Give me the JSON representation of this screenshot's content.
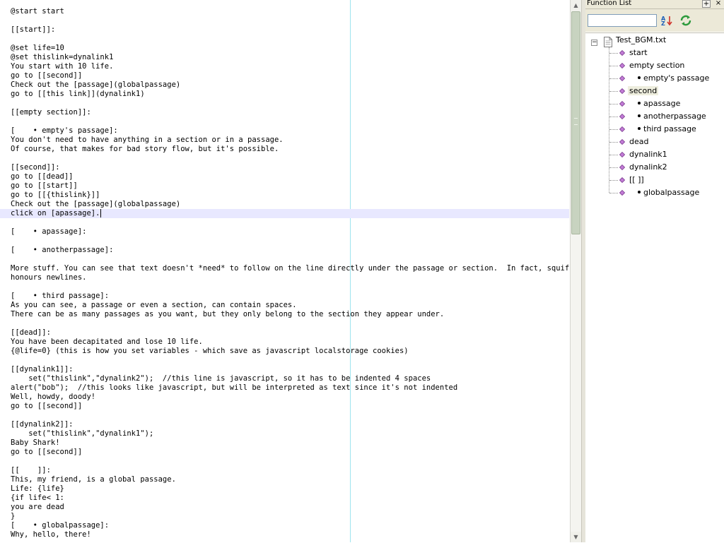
{
  "editor": {
    "lines": [
      "@start start",
      "",
      "[[start]]:",
      "",
      "@set life=10",
      "@set thislink=dynalink1",
      "You start with 10 life.",
      "go to [[second]]",
      "Check out the [passage](globalpassage)",
      "go to [[this link]](dynalink1)",
      "",
      "[[empty section]]:",
      "",
      "[    • empty's passage]:",
      "You don't need to have anything in a section or in a passage.",
      "Of course, that makes for bad story flow, but it's possible.",
      "",
      "[[second]]:",
      "go to [[dead]]",
      "go to [[start]]",
      "go to [[{thislink}]]",
      "Check out the [passage](globalpassage)",
      "click on [apassage].",
      "",
      "[    • apassage]:",
      "",
      "[    • anotherpassage]:",
      "",
      "More stuff. You can see that text doesn't *need* to follow on the line directly under the passage or section.  In fact, squiffy",
      "honours newlines.",
      "",
      "[    • third passage]:",
      "As you can see, a passage or even a section, can contain spaces.",
      "There can be as many passages as you want, but they only belong to the section they appear under.",
      "",
      "[[dead]]:",
      "You have been decapitated and lose 10 life.",
      "{@life=0} (this is how you set variables - which save as javascript localstorage cookies)",
      "",
      "[[dynalink1]]:",
      "    set(\"thislink\",\"dynalink2\");  //this line is javascript, so it has to be indented 4 spaces",
      "alert(\"bob\");  //this looks like javascript, but will be interpreted as text since it's not indented",
      "Well, howdy, doody!",
      "go to [[second]]",
      "",
      "[[dynalink2]]:",
      "    set(\"thislink\",\"dynalink1\");",
      "Baby Shark!",
      "go to [[second]]",
      "",
      "[[    ]]:",
      "This, my friend, is a global passage.",
      "Life: {life}",
      "{if life< 1:",
      "you are dead",
      "}",
      "[    • globalpassage]:",
      "Why, hello, there!"
    ],
    "current_line": 22
  },
  "function_list": {
    "title": "Function List",
    "add_label": "+",
    "close_label": "×",
    "search_placeholder": "",
    "search_value": "",
    "sort_icon": "sort-az-icon",
    "refresh_icon": "refresh-icon",
    "root_label": "Test_BGM.txt",
    "root_toggle": "−",
    "items": [
      {
        "label": "start",
        "level": 0,
        "bullet": false
      },
      {
        "label": "empty section",
        "level": 0,
        "bullet": false
      },
      {
        "label": "empty's passage",
        "level": 1,
        "bullet": true
      },
      {
        "label": "second",
        "level": 0,
        "bullet": false,
        "selected": true
      },
      {
        "label": "apassage",
        "level": 1,
        "bullet": true
      },
      {
        "label": "anotherpassage",
        "level": 1,
        "bullet": true
      },
      {
        "label": "third passage",
        "level": 1,
        "bullet": true
      },
      {
        "label": "dead",
        "level": 0,
        "bullet": false
      },
      {
        "label": "dynalink1",
        "level": 0,
        "bullet": false
      },
      {
        "label": "dynalink2",
        "level": 0,
        "bullet": false
      },
      {
        "label": "[[     ]]",
        "level": 0,
        "bullet": false
      },
      {
        "label": "globalpassage",
        "level": 1,
        "bullet": true
      }
    ]
  },
  "colors": {
    "current_line_bg": "#e8e8ff",
    "edge_marker": "#9fe4ee",
    "gem_fill": "#c27bd6",
    "gem_stroke": "#7a3a8e",
    "panel_chrome": "#ece9d8",
    "scroll_thumb": "#c8d3c0"
  }
}
